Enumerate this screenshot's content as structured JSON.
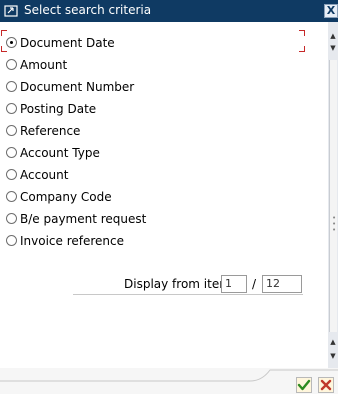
{
  "window": {
    "title": "Select search criteria",
    "close_symbol": "X"
  },
  "options": [
    {
      "label": "Document Date",
      "selected": true
    },
    {
      "label": "Amount",
      "selected": false
    },
    {
      "label": "Document Number",
      "selected": false
    },
    {
      "label": "Posting Date",
      "selected": false
    },
    {
      "label": "Reference",
      "selected": false
    },
    {
      "label": "Account Type",
      "selected": false
    },
    {
      "label": "Account",
      "selected": false
    },
    {
      "label": "Company Code",
      "selected": false
    },
    {
      "label": "B/e payment request",
      "selected": false
    },
    {
      "label": "Invoice reference",
      "selected": false
    }
  ],
  "display": {
    "label": "Display from item",
    "from_value": "1",
    "separator": "/",
    "total_value": "12"
  },
  "icons": {
    "title": "window-icon",
    "confirm": "checkmark-icon",
    "cancel": "cancel-icon"
  },
  "colors": {
    "title_bar": "#0f3a63",
    "focus_bracket": "#c62828",
    "confirm": "#2e8b1f",
    "cancel": "#c0392b"
  }
}
